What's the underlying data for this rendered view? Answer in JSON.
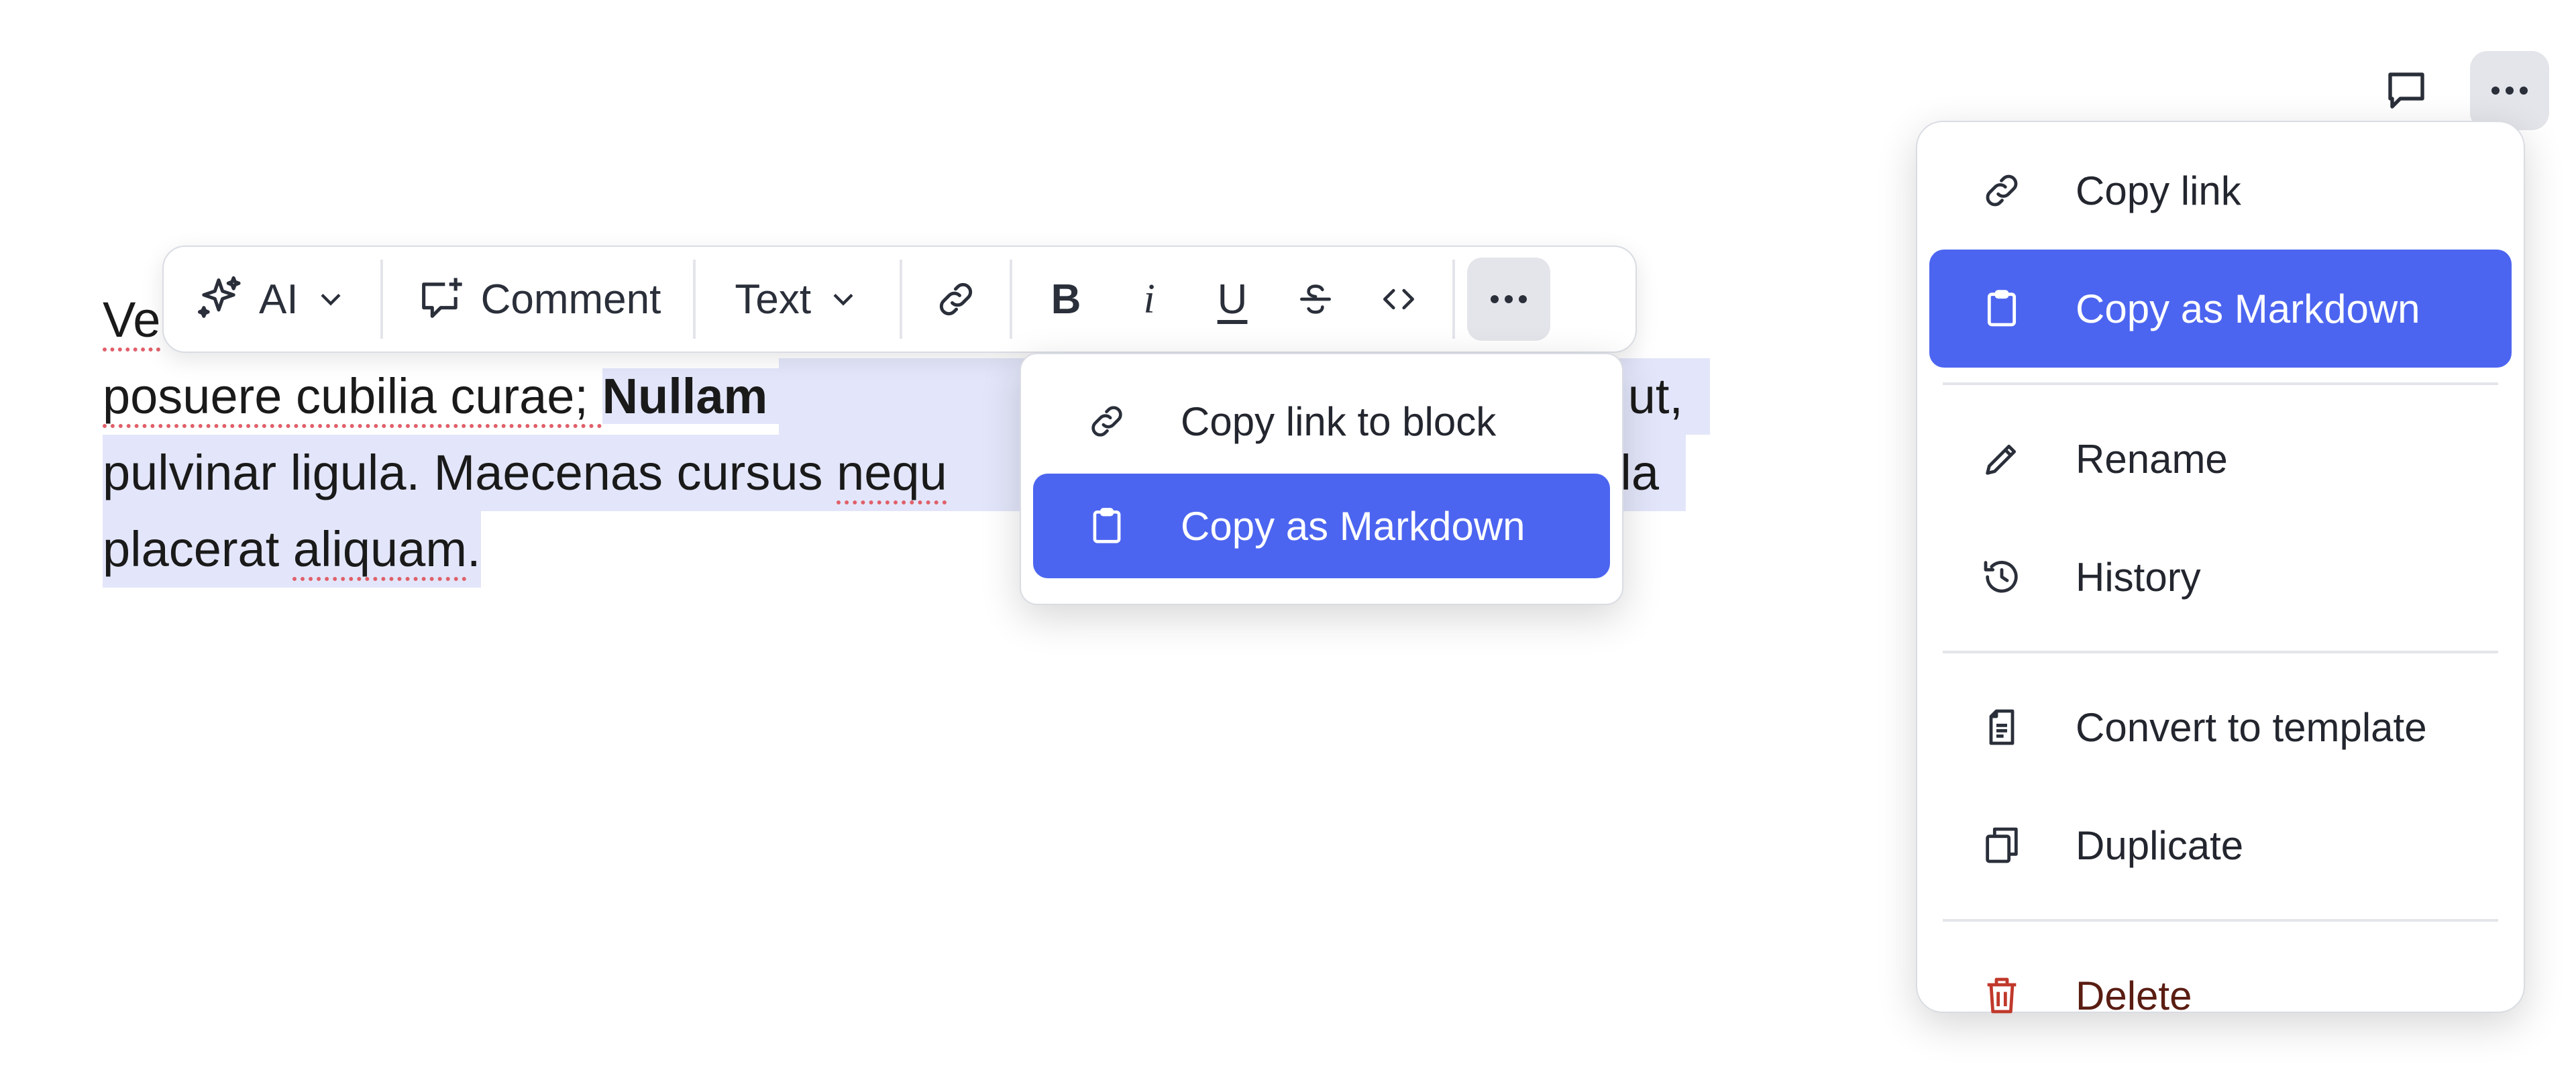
{
  "document": {
    "line1_visible": "Ve",
    "line2_plain": "posuere cubilia curae; ",
    "line2_bold": "Nullam vitae eli",
    "line2_tail": "ut,",
    "line3_plain": "pulvinar ligula. Maecenas cursus ",
    "line3_spell": "nequ",
    "line3_tail": "la",
    "line4_plain": "placerat ",
    "line4_spell": "aliquam",
    "line4_end": "."
  },
  "toolbar": {
    "ai_label": "AI",
    "comment_label": "Comment",
    "text_style_label": "Text",
    "bold_label": "B",
    "italic_label": "i",
    "underline_label": "U"
  },
  "block_menu": {
    "items": [
      {
        "label": "Copy link to block",
        "icon": "link-icon"
      },
      {
        "label": "Copy as Markdown",
        "icon": "clipboard-icon",
        "active": true
      }
    ]
  },
  "page_menu": {
    "items": [
      {
        "label": "Copy link",
        "icon": "link-icon"
      },
      {
        "label": "Copy as Markdown",
        "icon": "clipboard-icon",
        "active": true
      },
      {
        "label": "Rename",
        "icon": "pencil-icon"
      },
      {
        "label": "History",
        "icon": "history-icon"
      },
      {
        "label": "Convert to template",
        "icon": "document-icon"
      },
      {
        "label": "Duplicate",
        "icon": "duplicate-icon"
      },
      {
        "label": "Delete",
        "icon": "trash-icon"
      }
    ]
  },
  "colors": {
    "accent": "#4c65f0",
    "selection": "#e3e6fa",
    "danger_text": "#5a1d12",
    "danger_icon": "#c0392b"
  }
}
